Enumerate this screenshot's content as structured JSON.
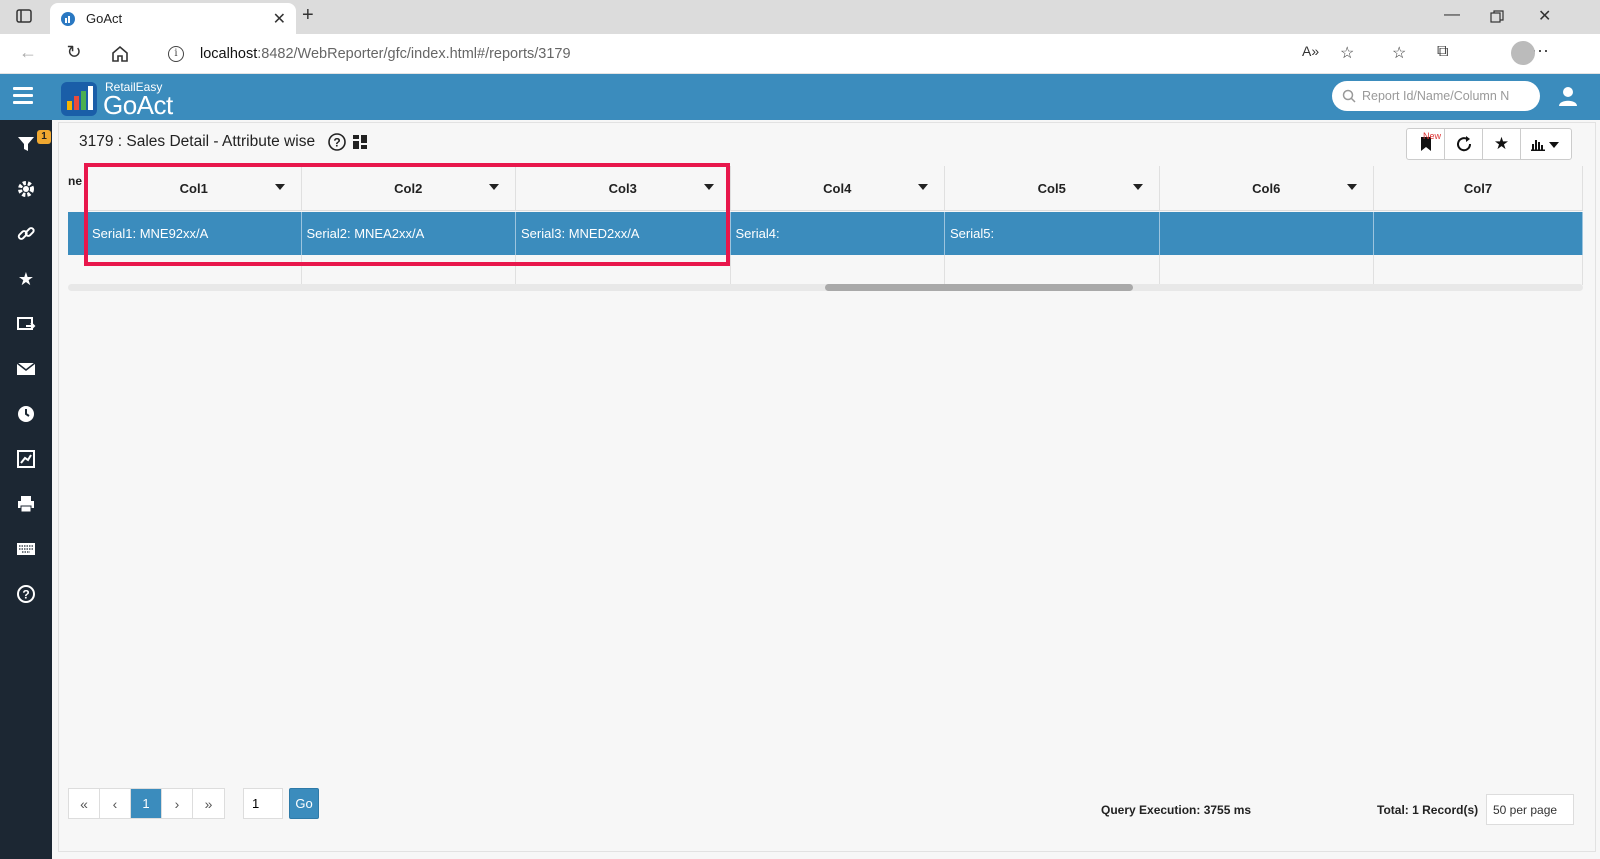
{
  "browser": {
    "tab_title": "GoAct",
    "url_host": "localhost",
    "url_rest": ":8482/WebReporter/gfc/index.html#/reports/3179"
  },
  "app": {
    "logo_sub": "RetailEasy",
    "logo_main": "GoAct",
    "search_placeholder": "Report Id/Name/Column N",
    "filter_badge": "1",
    "brand_color": "#3b8cbd",
    "sidebar_color": "#1c2733"
  },
  "report": {
    "title": "3179 : Sales Detail - Attribute wise",
    "new_label": "New",
    "cut_header": "ne"
  },
  "grid": {
    "columns": [
      "Col1",
      "Col2",
      "Col3",
      "Col4",
      "Col5",
      "Col6",
      "Col7"
    ],
    "row": [
      "Serial1: MNE92xx/A",
      "Serial2: MNEA2xx/A",
      "Serial3: MNED2xx/A",
      "Serial4:",
      "Serial5:",
      "",
      ""
    ],
    "highlight_color": "#e8174c"
  },
  "pager": {
    "first": "«",
    "prev": "‹",
    "current": "1",
    "next": "›",
    "last": "»",
    "page_input": "1",
    "go_label": "Go"
  },
  "footer": {
    "query_execution": "Query Execution: 3755 ms",
    "total": "Total: 1 Record(s)",
    "per_page": "50 per page"
  }
}
